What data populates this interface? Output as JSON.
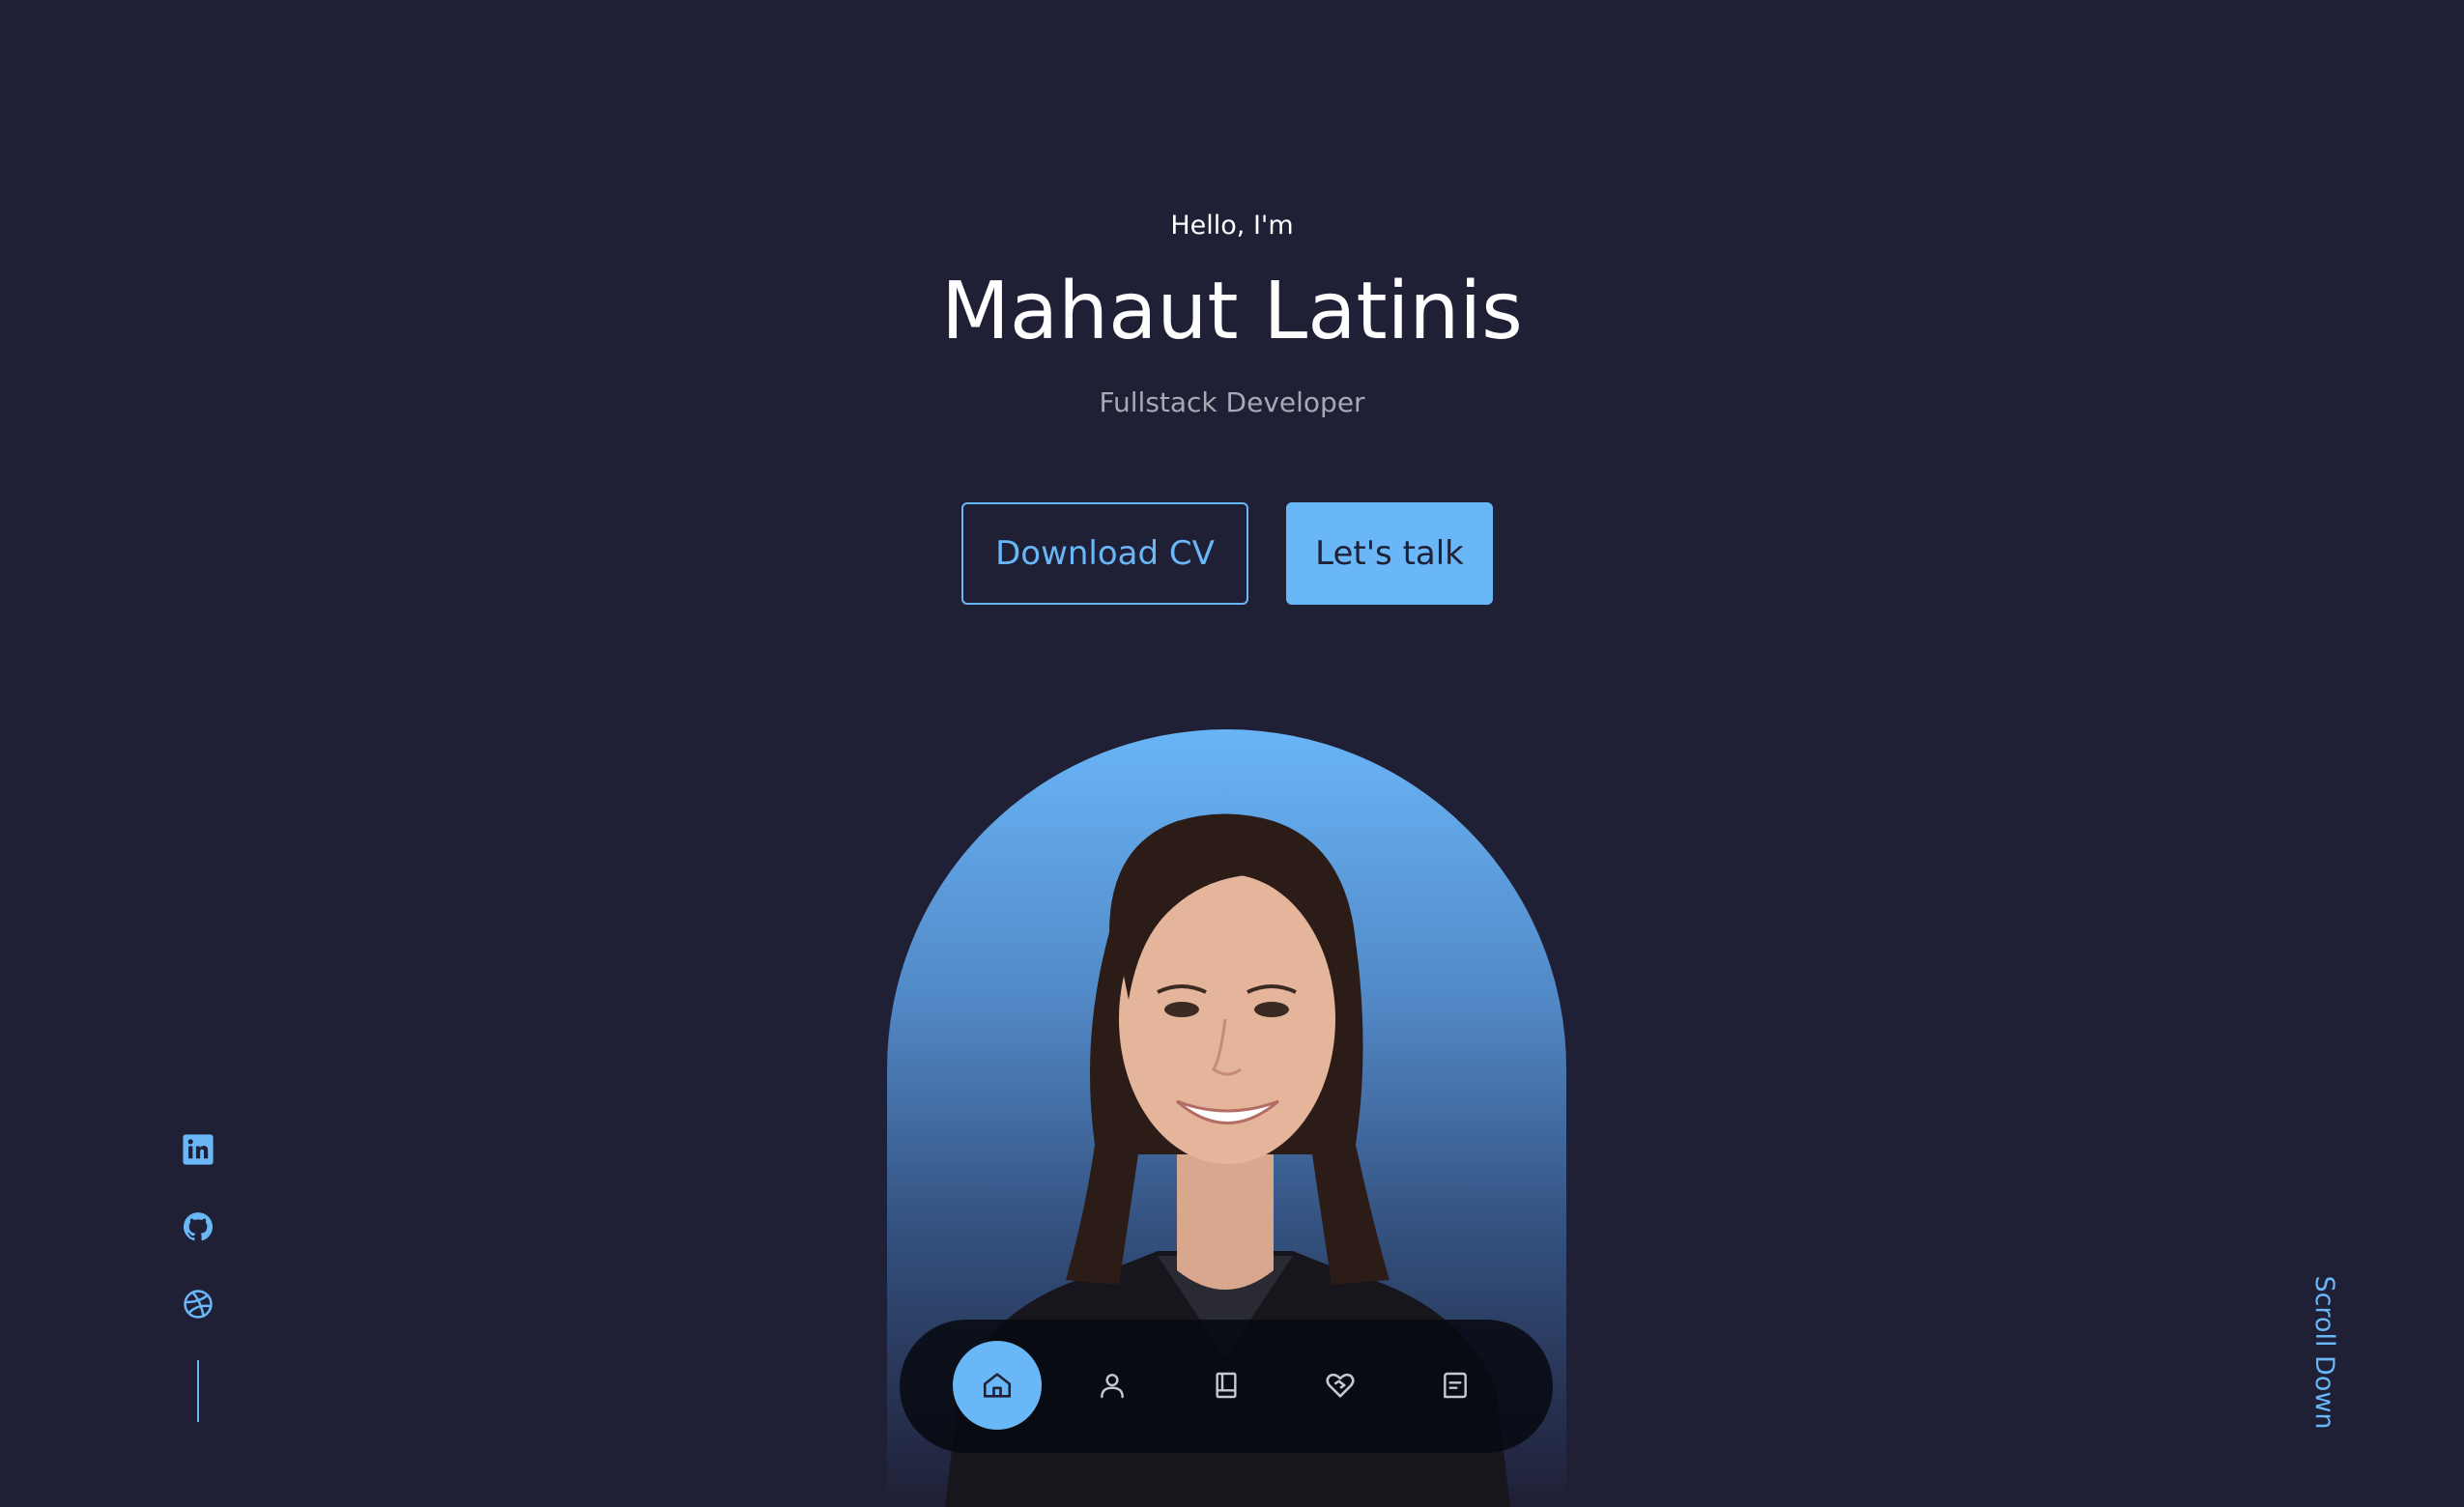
{
  "hero": {
    "greeting": "Hello, I'm",
    "name": "Mahaut Latinis",
    "role": "Fullstack Developer",
    "download_cv_label": "Download CV",
    "lets_talk_label": "Let's talk"
  },
  "nav": {
    "items": [
      {
        "icon": "home-icon",
        "active": true
      },
      {
        "icon": "user-icon",
        "active": false
      },
      {
        "icon": "book-icon",
        "active": false
      },
      {
        "icon": "heart-handshake-icon",
        "active": false
      },
      {
        "icon": "message-icon",
        "active": false
      }
    ]
  },
  "social": {
    "items": [
      {
        "icon": "linkedin-icon"
      },
      {
        "icon": "github-icon"
      },
      {
        "icon": "dribbble-icon"
      }
    ]
  },
  "scroll": {
    "label": "Scroll Down"
  },
  "colors": {
    "background": "#1f1f35",
    "accent": "#6ab7f8",
    "text": "#ffffff",
    "muted": "#a9a9b5"
  }
}
